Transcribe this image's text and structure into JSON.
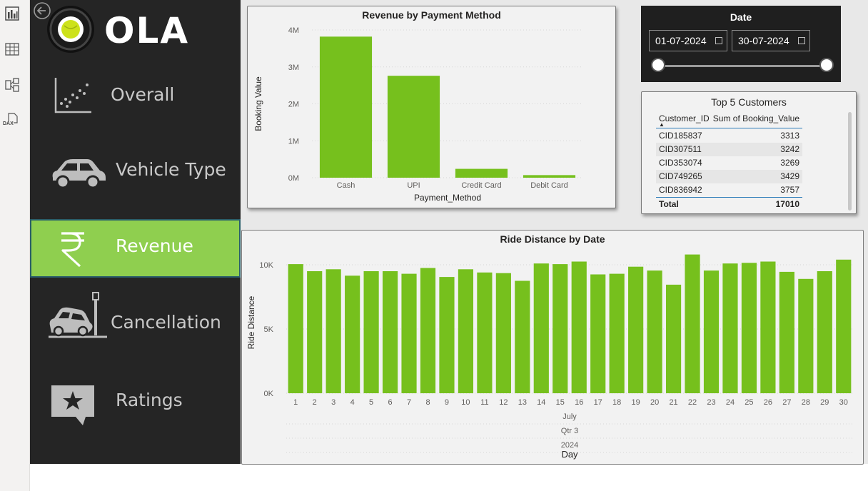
{
  "rail": {
    "icons": [
      "report-view-icon",
      "table-view-icon",
      "model-view-icon",
      "dax-query-icon"
    ],
    "dax_label": "DAX"
  },
  "brand": {
    "logo_text": "OLA"
  },
  "nav": {
    "items": [
      {
        "label": "Overall",
        "icon": "scatter-chart-icon",
        "active": false
      },
      {
        "label": "Vehicle Type",
        "icon": "car-icon",
        "active": false
      },
      {
        "label": "Revenue",
        "icon": "rupee-icon",
        "active": true
      },
      {
        "label": "Cancellation",
        "icon": "car-crash-icon",
        "active": false
      },
      {
        "label": "Ratings",
        "icon": "star-bubble-icon",
        "active": false
      }
    ],
    "accent": "#8fcf4f"
  },
  "date_slicer": {
    "title": "Date",
    "start": "01-07-2024",
    "end": "30-07-2024"
  },
  "top_customers": {
    "title": "Top 5 Customers",
    "columns": [
      "Customer_ID",
      "Sum of Booking_Value"
    ],
    "rows": [
      [
        "CID185837",
        "3313"
      ],
      [
        "CID307511",
        "3242"
      ],
      [
        "CID353074",
        "3269"
      ],
      [
        "CID749265",
        "3429"
      ],
      [
        "CID836942",
        "3757"
      ]
    ],
    "total_label": "Total",
    "total_value": "17010"
  },
  "chart_data": [
    {
      "type": "bar",
      "title": "Revenue by Payment Method",
      "xlabel": "Payment_Method",
      "ylabel": "Booking Value",
      "categories": [
        "Cash",
        "UPI",
        "Credit Card",
        "Debit Card"
      ],
      "values": [
        3820000,
        2760000,
        240000,
        70000
      ],
      "ylim": [
        0,
        4000000
      ],
      "yticks": [
        "0M",
        "1M",
        "2M",
        "3M",
        "4M"
      ],
      "color": "#76c01d"
    },
    {
      "type": "bar",
      "title": "Ride Distance by Date",
      "xlabel": "Day",
      "ylabel": "Ride Distance",
      "categories": [
        "1",
        "2",
        "3",
        "4",
        "5",
        "6",
        "7",
        "8",
        "9",
        "10",
        "11",
        "12",
        "13",
        "14",
        "15",
        "16",
        "17",
        "18",
        "19",
        "20",
        "21",
        "22",
        "23",
        "24",
        "25",
        "26",
        "27",
        "28",
        "29",
        "30"
      ],
      "values": [
        10050,
        9500,
        9650,
        9150,
        9500,
        9500,
        9300,
        9750,
        9050,
        9650,
        9400,
        9350,
        8750,
        10100,
        10050,
        10250,
        9250,
        9300,
        9850,
        9550,
        8450,
        10800,
        9550,
        10100,
        10150,
        10250,
        9450,
        8900,
        9500,
        10400
      ],
      "ylim": [
        0,
        11000
      ],
      "yticks": [
        "0K",
        "5K",
        "10K"
      ],
      "hierarchy": [
        "July",
        "Qtr 3",
        "2024"
      ],
      "color": "#76c01d"
    }
  ]
}
